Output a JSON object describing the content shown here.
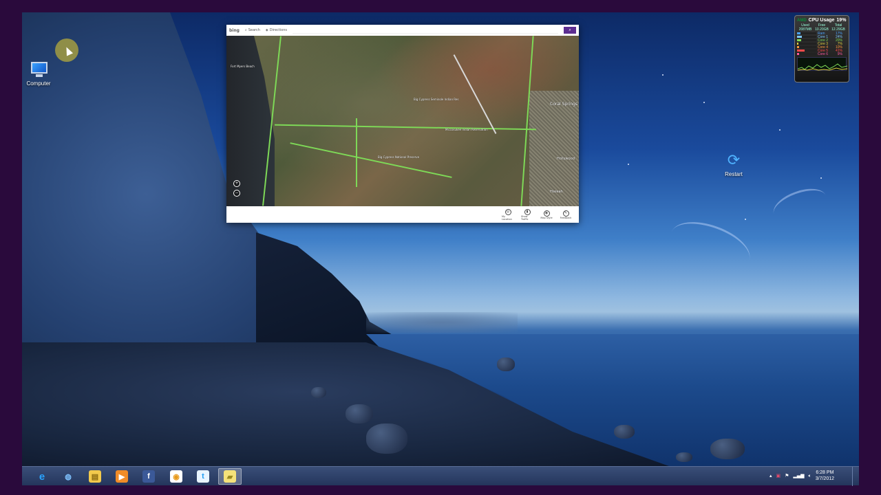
{
  "desktop": {
    "icons": [
      {
        "label": "Computer",
        "icon": "computer-icon"
      },
      {
        "label": "Restart",
        "icon": "restart-icon"
      }
    ]
  },
  "cpu_gadget": {
    "brand": "AMD",
    "title": "CPU Usage",
    "total_percent": "19%",
    "memory_headers": [
      "Used",
      "Free",
      "Total"
    ],
    "memory_values": [
      "2087MB",
      "10.20GB",
      "12.29GB"
    ],
    "rows": [
      {
        "name": "Ram",
        "percent": "17%",
        "fraction": 0.17,
        "color": "#4aa3ff"
      },
      {
        "name": "Core 1",
        "percent": "24%",
        "fraction": 0.24,
        "color": "#7ec8ff"
      },
      {
        "name": "Core 2",
        "percent": "20%",
        "fraction": 0.2,
        "color": "#7ed957"
      },
      {
        "name": "Core 3",
        "percent": "7%",
        "fraction": 0.07,
        "color": "#e0d040"
      },
      {
        "name": "Core 4",
        "percent": "10%",
        "fraction": 0.1,
        "color": "#ff9a3c"
      },
      {
        "name": "Core 5",
        "percent": "41%",
        "fraction": 0.41,
        "color": "#ff4a4a"
      },
      {
        "name": "Core 6",
        "percent": "9%",
        "fraction": 0.09,
        "color": "#ff5aa0"
      }
    ]
  },
  "maps": {
    "logo": "bing",
    "search_label": "Search",
    "directions_label": "Directions",
    "labels": [
      "Fort Myers Beach",
      "Big Cypress Seminole Indian Res",
      "Big Cypress National Preserve",
      "Miccosukee Indian Reservation",
      "Coral Springs",
      "Hollywood",
      "Hialeah"
    ],
    "appbar": [
      "My Location",
      "Show Traffic",
      "Map Style",
      "Feedback"
    ],
    "colors": {
      "roads": "#7ed957",
      "go_button": "#5c2d91"
    }
  },
  "taskbar": {
    "apps": [
      {
        "name": "internet-explorer",
        "glyph": "e"
      },
      {
        "name": "globe",
        "glyph": "◍"
      },
      {
        "name": "file-explorer",
        "glyph": "▤"
      },
      {
        "name": "media-player",
        "glyph": "▶"
      },
      {
        "name": "facebook",
        "glyph": "f"
      },
      {
        "name": "music",
        "glyph": "◉"
      },
      {
        "name": "twitter",
        "glyph": "t"
      },
      {
        "name": "maps",
        "glyph": "▰"
      }
    ],
    "tray": {
      "time": "6:28 PM",
      "date": "3/7/2012"
    }
  }
}
